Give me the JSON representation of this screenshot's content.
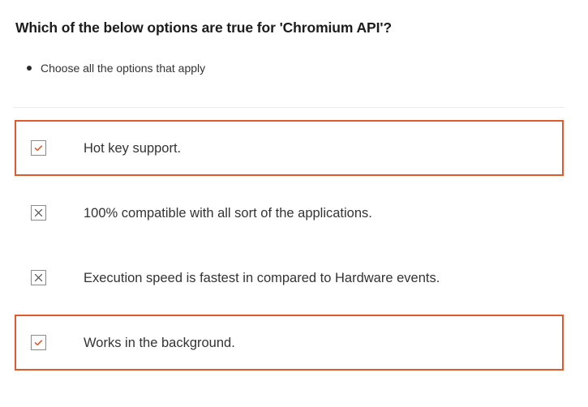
{
  "question": {
    "text": "Which of the below options are true for 'Chromium API'?"
  },
  "instructions": [
    "Choose all the options that apply"
  ],
  "accent_color": "#e05a2b",
  "options": [
    {
      "label": "Hot key support.",
      "state": "checked",
      "selected": true,
      "icon": "check-icon"
    },
    {
      "label": "100% compatible with all sort of the applications.",
      "state": "crossed",
      "selected": false,
      "icon": "cross-icon"
    },
    {
      "label": "Execution speed is fastest in compared to Hardware events.",
      "state": "crossed",
      "selected": false,
      "icon": "cross-icon"
    },
    {
      "label": "Works in the background.",
      "state": "checked",
      "selected": true,
      "icon": "check-icon"
    }
  ]
}
